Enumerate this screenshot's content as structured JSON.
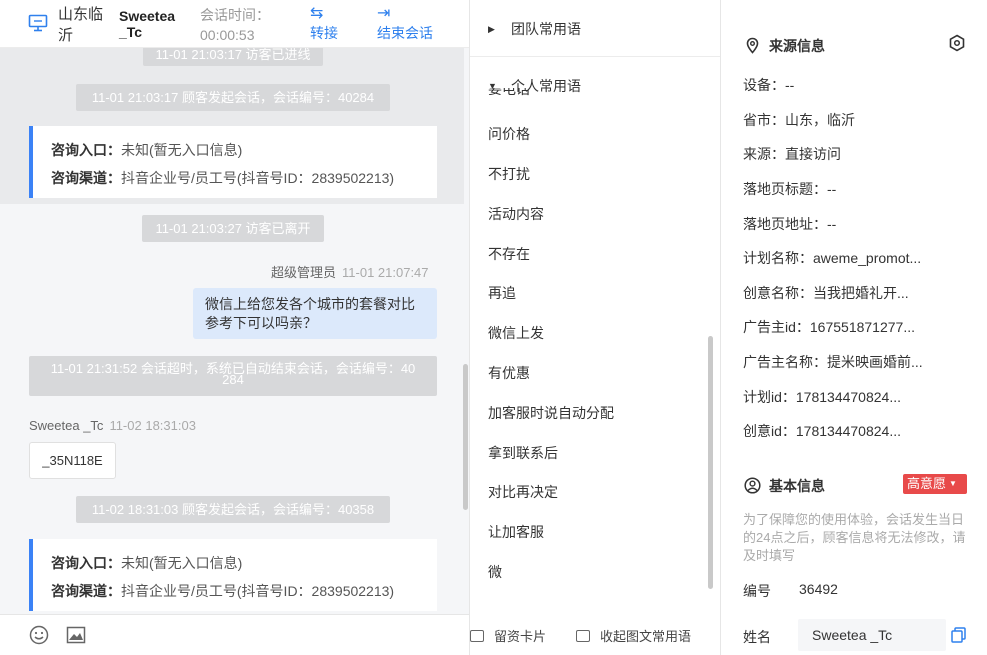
{
  "header": {
    "location": "山东临沂",
    "visitor_name": "Sweetea _Tc",
    "session_time_label": "会话时间：",
    "session_time": "00:00:53",
    "transfer_label": "转接",
    "end_label": "结束会话"
  },
  "chat": {
    "messages": {
      "sys_entered": "11-01 21:03:17 访客已进线",
      "sys_start_1": "11-01 21:03:17 顾客发起会话，会话编号：40284",
      "card1_entry_label": "咨询入口：",
      "card1_entry_value": "未知(暂无入口信息)",
      "card1_channel_label": "咨询渠道：",
      "card1_channel_value": "抖音企业号/员工号(抖音号ID：2839502213)",
      "sys_left": "11-01 21:03:27 访客已离开",
      "agent_name": "超级管理员",
      "agent_time": "11-01 21:07:47",
      "agent_message": "微信上给您发各个城市的套餐对比参考下可以吗亲？",
      "sys_timeout_line1": "11-01 21:31:52 会话超时，系统已自动结束会话，会话编号：40",
      "sys_timeout_line2": "284",
      "visitor_name": "Sweetea _Tc",
      "visitor_time": "11-02 18:31:03",
      "visitor_message": "_35N118E",
      "sys_start_2": "11-02 18:31:03 顾客发起会话，会话编号：40358",
      "card2_entry_label": "咨询入口：",
      "card2_entry_value": "未知(暂无入口信息)",
      "card2_channel_label": "咨询渠道：",
      "card2_channel_value": "抖音企业号/员工号(抖音号ID：2839502213)"
    }
  },
  "footer": {
    "card_label": "留资卡片",
    "collapse_label": "收起图文常用语"
  },
  "phrases": {
    "team_group": "团队常用语",
    "personal_group": "个人常用语",
    "partial_item": "要电话",
    "items": [
      "问价格",
      "不打扰",
      "活动内容",
      "不存在",
      "再追",
      "微信上发",
      "有优惠",
      "加客服时说自动分配",
      "拿到联系后",
      "对比再决定",
      "让加客服",
      "微"
    ]
  },
  "info": {
    "source_title": "来源信息",
    "device": "设备：--",
    "province": "省市：山东，临沂",
    "source": "来源：直接访问",
    "landing_title": "落地页标题：--",
    "landing_url": "落地页地址：--",
    "plan_name": "计划名称：aweme_promot...",
    "creative_name": "创意名称：当我把婚礼开...",
    "advertiser_id": "广告主id：167551871277...",
    "advertiser_name": "广告主名称：提米映画婚前...",
    "plan_id": "计划id：178134470824...",
    "creative_id": "创意id：178134470824...",
    "basic_title": "基本信息",
    "intent_tag": "高意愿",
    "intent_color": "#e84a4a",
    "note": "为了保障您的使用体验，会话发生当日的24点之后，顾客信息将无法修改，请及时填写",
    "number_label": "编号",
    "number_value": "36492",
    "name_label": "姓名",
    "name_value": "Sweetea _Tc"
  },
  "colors": {
    "accent": "#2f80ed",
    "card_border": "#3b82f6",
    "agent_bubble": "#dce9fb"
  }
}
